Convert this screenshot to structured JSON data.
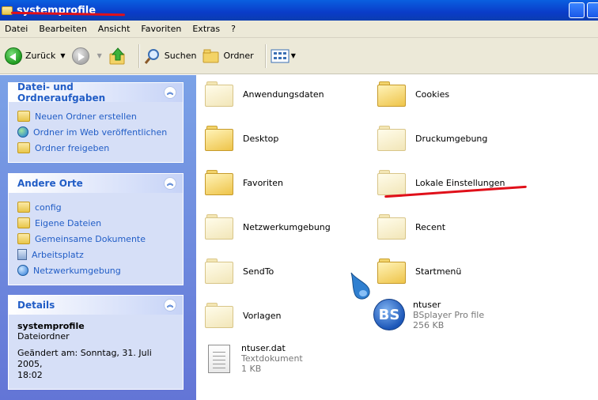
{
  "window": {
    "title": "systemprofile"
  },
  "menu": [
    "Datei",
    "Bearbeiten",
    "Ansicht",
    "Favoriten",
    "Extras",
    "?"
  ],
  "toolbar": {
    "back": "Zurück",
    "search": "Suchen",
    "folders": "Ordner"
  },
  "sidebar": {
    "tasks": {
      "title": "Datei- und Ordneraufgaben",
      "items": [
        "Neuen Ordner erstellen",
        "Ordner im Web veröffentlichen",
        "Ordner freigeben"
      ]
    },
    "places": {
      "title": "Andere Orte",
      "items": [
        "config",
        "Eigene Dateien",
        "Gemeinsame Dokumente",
        "Arbeitsplatz",
        "Netzwerkumgebung"
      ]
    },
    "details": {
      "title": "Details",
      "name": "systemprofile",
      "type": "Dateiordner",
      "modified_line1": "Geändert am: Sonntag, 31. Juli 2005,",
      "modified_line2": "18:02"
    }
  },
  "files": [
    {
      "name": "Anwendungsdaten"
    },
    {
      "name": "Cookies"
    },
    {
      "name": "Desktop"
    },
    {
      "name": "Druckumgebung"
    },
    {
      "name": "Favoriten"
    },
    {
      "name": "Lokale Einstellungen"
    },
    {
      "name": "Netzwerkumgebung"
    },
    {
      "name": "Recent"
    },
    {
      "name": "SendTo"
    },
    {
      "name": "Startmenü"
    },
    {
      "name": "Vorlagen"
    },
    {
      "name": "ntuser",
      "type": "BSplayer Pro file",
      "size": "256 KB",
      "icon_text": "BS"
    },
    {
      "name": "ntuser.dat",
      "type": "Textdokument",
      "size": "1 KB"
    }
  ],
  "colors": {
    "titlebar": "#0a4fd8",
    "task_link": "#215dc6",
    "annotation": "#e0101a"
  }
}
